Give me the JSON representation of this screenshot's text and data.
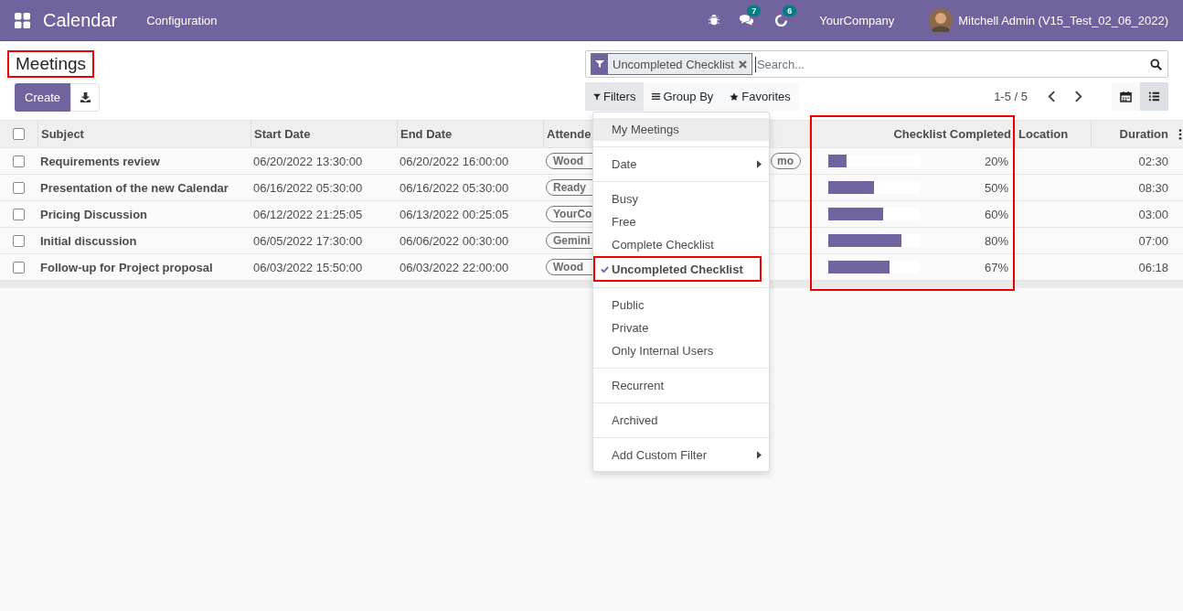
{
  "navbar": {
    "app_name": "Calendar",
    "menu": [
      "Configuration"
    ],
    "messages_count": "7",
    "activities_count": "6",
    "company": "YourCompany",
    "user": "Mitchell Admin (V15_Test_02_06_2022)"
  },
  "title": {
    "text": "Meetings",
    "highlighted": true
  },
  "create_button": "Create",
  "search": {
    "facet": "Uncompleted Checklist",
    "placeholder": "Search..."
  },
  "search_options": [
    {
      "kind": "filter",
      "label": "Filters",
      "selected": true
    },
    {
      "kind": "group",
      "label": "Group By",
      "selected": false
    },
    {
      "kind": "favorite",
      "label": "Favorites",
      "selected": false
    }
  ],
  "pager": "1-5 / 5",
  "views": [
    {
      "kind": "calendar",
      "selected": false
    },
    {
      "kind": "list",
      "selected": true
    }
  ],
  "table": {
    "all_selected": false,
    "columns": [
      {
        "label": "Subject"
      },
      {
        "label": "Start Date"
      },
      {
        "label": "End Date"
      },
      {
        "label": "Attende"
      },
      {
        "label": "Checklist Completed",
        "highlighted": true
      },
      {
        "label": "Location"
      },
      {
        "label": "Duration"
      }
    ],
    "rows": [
      {
        "selected": false,
        "subject": "Requirements review",
        "start": "06/20/2022 13:30:00",
        "end": "06/20/2022 16:00:00",
        "attendees": [
          "Wood",
          "mo"
        ],
        "level": 0.2,
        "checklist": "20%",
        "duration": "02:30"
      },
      {
        "selected": false,
        "subject": "Presentation of the new Calendar",
        "start": "06/16/2022 05:30:00",
        "end": "06/16/2022 05:30:00",
        "attendees": [
          "Ready"
        ],
        "level": 0.5,
        "checklist": "50%",
        "duration": "08:30"
      },
      {
        "selected": false,
        "subject": "Pricing Discussion",
        "start": "06/12/2022 21:25:05",
        "end": "06/13/2022 00:25:05",
        "attendees": [
          "YourCo"
        ],
        "level": 0.6,
        "checklist": "60%",
        "duration": "03:00"
      },
      {
        "selected": false,
        "subject": "Initial discussion",
        "start": "06/05/2022 17:30:00",
        "end": "06/06/2022 00:30:00",
        "attendees": [
          "Gemini"
        ],
        "level": 0.8,
        "checklist": "80%",
        "duration": "07:00"
      },
      {
        "selected": false,
        "subject": "Follow-up for Project proposal",
        "start": "06/03/2022 15:50:00",
        "end": "06/03/2022 22:00:00",
        "attendees": [
          "Wood"
        ],
        "level": 0.67,
        "checklist": "67%",
        "duration": "06:18"
      }
    ]
  },
  "filters_menu": {
    "groups": [
      {
        "items": [
          {
            "kind": "option",
            "label": "My Meetings",
            "checked": false,
            "hovered": true,
            "highlighted": false
          }
        ]
      },
      {
        "items": [
          {
            "kind": "submenu",
            "label": "Date",
            "checked": false,
            "hovered": false,
            "highlighted": false
          }
        ]
      },
      {
        "items": [
          {
            "kind": "option",
            "label": "Busy",
            "checked": false,
            "hovered": false,
            "highlighted": false
          },
          {
            "kind": "option",
            "label": "Free",
            "checked": false,
            "hovered": false,
            "highlighted": false
          },
          {
            "kind": "option",
            "label": "Complete Checklist",
            "checked": false,
            "hovered": false,
            "highlighted": false
          },
          {
            "kind": "option",
            "label": "Uncompleted Checklist",
            "checked": true,
            "hovered": false,
            "highlighted": true
          }
        ]
      },
      {
        "items": [
          {
            "kind": "option",
            "label": "Public",
            "checked": false,
            "hovered": false,
            "highlighted": false
          },
          {
            "kind": "option",
            "label": "Private",
            "checked": false,
            "hovered": false,
            "highlighted": false
          },
          {
            "kind": "option",
            "label": "Only Internal Users",
            "checked": false,
            "hovered": false,
            "highlighted": false
          }
        ]
      },
      {
        "items": [
          {
            "kind": "option",
            "label": "Recurrent",
            "checked": false,
            "hovered": false,
            "highlighted": false
          }
        ]
      },
      {
        "items": [
          {
            "kind": "option",
            "label": "Archived",
            "checked": false,
            "hovered": false,
            "highlighted": false
          }
        ]
      },
      {
        "items": [
          {
            "kind": "submenu",
            "label": "Add Custom Filter",
            "checked": false,
            "hovered": false,
            "highlighted": false
          }
        ]
      }
    ]
  }
}
